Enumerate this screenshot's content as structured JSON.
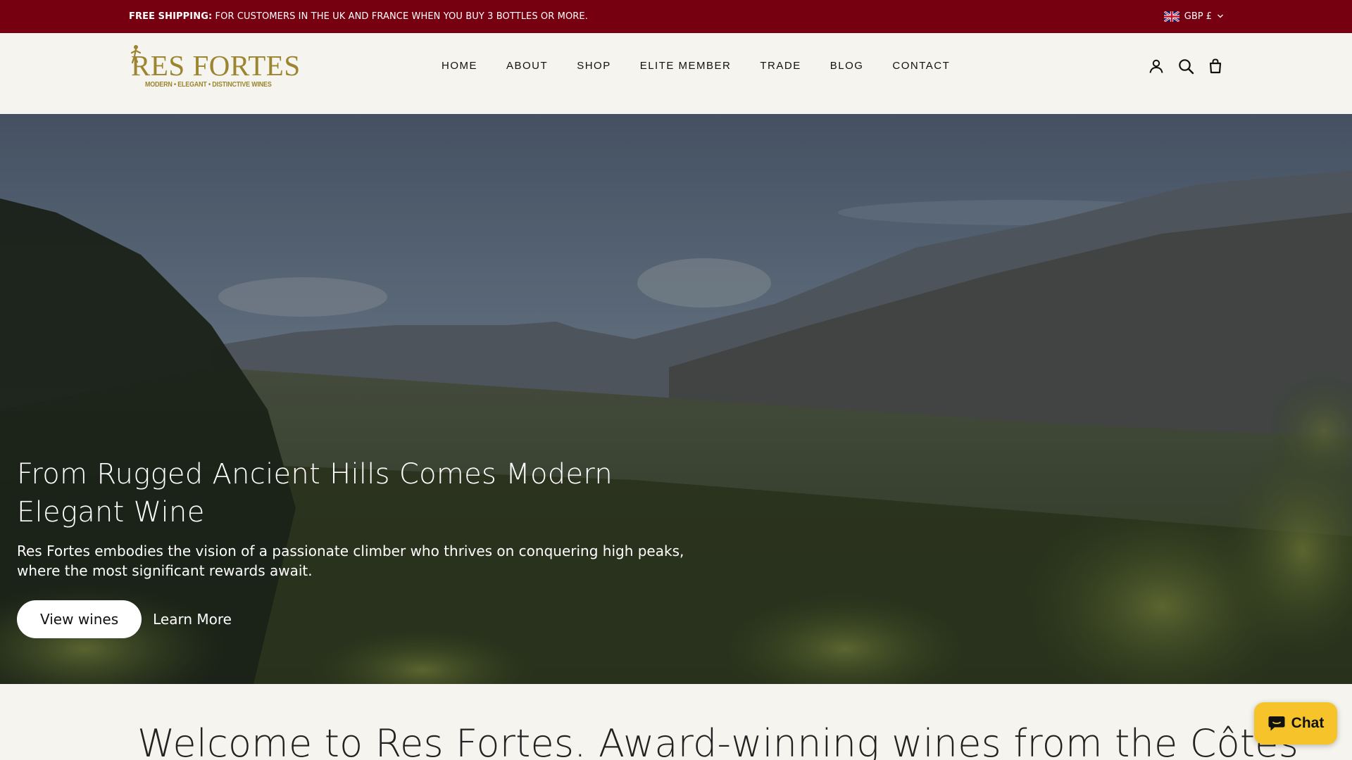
{
  "announcement": {
    "label": "FREE SHIPPING:",
    "text": " FOR CUSTOMERS IN THE UK AND FRANCE WHEN YOU BUY 3 BOTTLES OR MORE."
  },
  "currency": {
    "value": "GBP £",
    "flag_icon": "uk-flag-icon"
  },
  "logo": {
    "wordmark": "RES FORTES",
    "tagline": "MODERN • ELEGANT • DISTINCTIVE WINES",
    "color": "#9b8530"
  },
  "nav": {
    "items": [
      {
        "label": "HOME"
      },
      {
        "label": "ABOUT"
      },
      {
        "label": "SHOP"
      },
      {
        "label": "ELITE MEMBER"
      },
      {
        "label": "TRADE"
      },
      {
        "label": "BLOG"
      },
      {
        "label": "CONTACT"
      }
    ]
  },
  "header_icons": [
    "account-icon",
    "search-icon",
    "cart-icon"
  ],
  "hero": {
    "title": "From Rugged Ancient Hills Comes Modern Elegant Wine",
    "subtitle": "Res Fortes embodies the vision of a passionate climber who thrives on conquering high peaks, where the most significant rewards await.",
    "primary_cta": "View wines",
    "secondary_cta": "Learn More"
  },
  "welcome": {
    "heading": "Welcome to Res Fortes. Award-winning wines from the Côtes"
  },
  "chat": {
    "label": "Chat"
  },
  "colors": {
    "announcement_bg": "#770010",
    "page_bg": "#f5f4ee",
    "chat_bg": "#f6c32b"
  }
}
